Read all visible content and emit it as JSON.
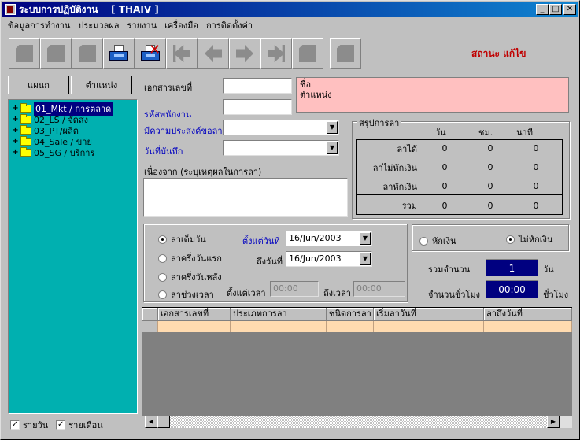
{
  "window": {
    "title": "ระบบการปฏิบัติงาน    [ THAIV ]"
  },
  "menu": [
    "ข้อมูลการทำงาน",
    "ประมวลผล",
    "รายงาน",
    "เครื่องมือ",
    "การติดตั้งค่า"
  ],
  "status": "สถานะ แก้ไข",
  "left": {
    "tabs": [
      "แผนก",
      "ตำแหน่ง"
    ],
    "tree": [
      "01_Mkt / การตลาด",
      "02_LS / จัดส่ง",
      "03_PT/ผลิต",
      "04_Sale / ขาย",
      "05_SG / บริการ"
    ],
    "checks": [
      "รายวัน",
      "รายเดือน"
    ]
  },
  "form": {
    "doc_no_label": "เอกสารเลขที่",
    "emp_id_label": "รหัสพนักงาน",
    "purpose_label": "มีความประสงค์ขอลา",
    "record_date_label": "วันที่บันทึก",
    "reason_label": "เนื่องจาก (ระบุเหตุผลในการลา)",
    "info_name_label": "ชื่อ",
    "info_pos_label": "ตำแหน่ง"
  },
  "summary": {
    "title": "สรุปการลา",
    "headers": [
      "วัน",
      "ชม.",
      "นาที"
    ],
    "rows": [
      {
        "label": "ลาได้",
        "values": [
          "0",
          "0",
          "0"
        ]
      },
      {
        "label": "ลาไม่หักเงิน",
        "values": [
          "0",
          "0",
          "0"
        ]
      },
      {
        "label": "ลาหักเงิน",
        "values": [
          "0",
          "0",
          "0"
        ]
      },
      {
        "label": "รวม",
        "values": [
          "0",
          "0",
          "0"
        ]
      }
    ]
  },
  "leave": {
    "options": [
      "ลาเต็มวัน",
      "ลาครึ่งวันแรก",
      "ลาครึ่งวันหลัง",
      "ลาช่วงเวลา"
    ],
    "from_date_label": "ตั้งแต่วันที่",
    "from_date": "16/Jun/2003",
    "to_date_label": "ถึงวันที่",
    "to_date": "16/Jun/2003",
    "from_time_label": "ตั้งแต่เวลา",
    "from_time": "00:00",
    "to_time_label": "ถึงเวลา",
    "to_time": "00:00"
  },
  "pay": {
    "options": [
      "หักเงิน",
      "ไม่หักเงิน"
    ],
    "total_label": "รวมจำนวน",
    "total_value": "1",
    "total_unit": "วัน",
    "hours_label": "จำนวนชั่วโมง",
    "hours_value": "00:00",
    "hours_unit": "ชั่วโมง"
  },
  "grid": {
    "columns": [
      "เอกสารเลขที่",
      "ประเภทการลา",
      "ชนิดการลา",
      "เริ่มลาวันที่",
      "ลาถึงวันที่"
    ]
  },
  "icons": [
    "new-icon",
    "open-icon",
    "copy-icon",
    "save-icon",
    "delete-icon",
    "first-icon",
    "prev-icon",
    "next-icon",
    "last-icon",
    "print-icon",
    "exit-icon"
  ]
}
